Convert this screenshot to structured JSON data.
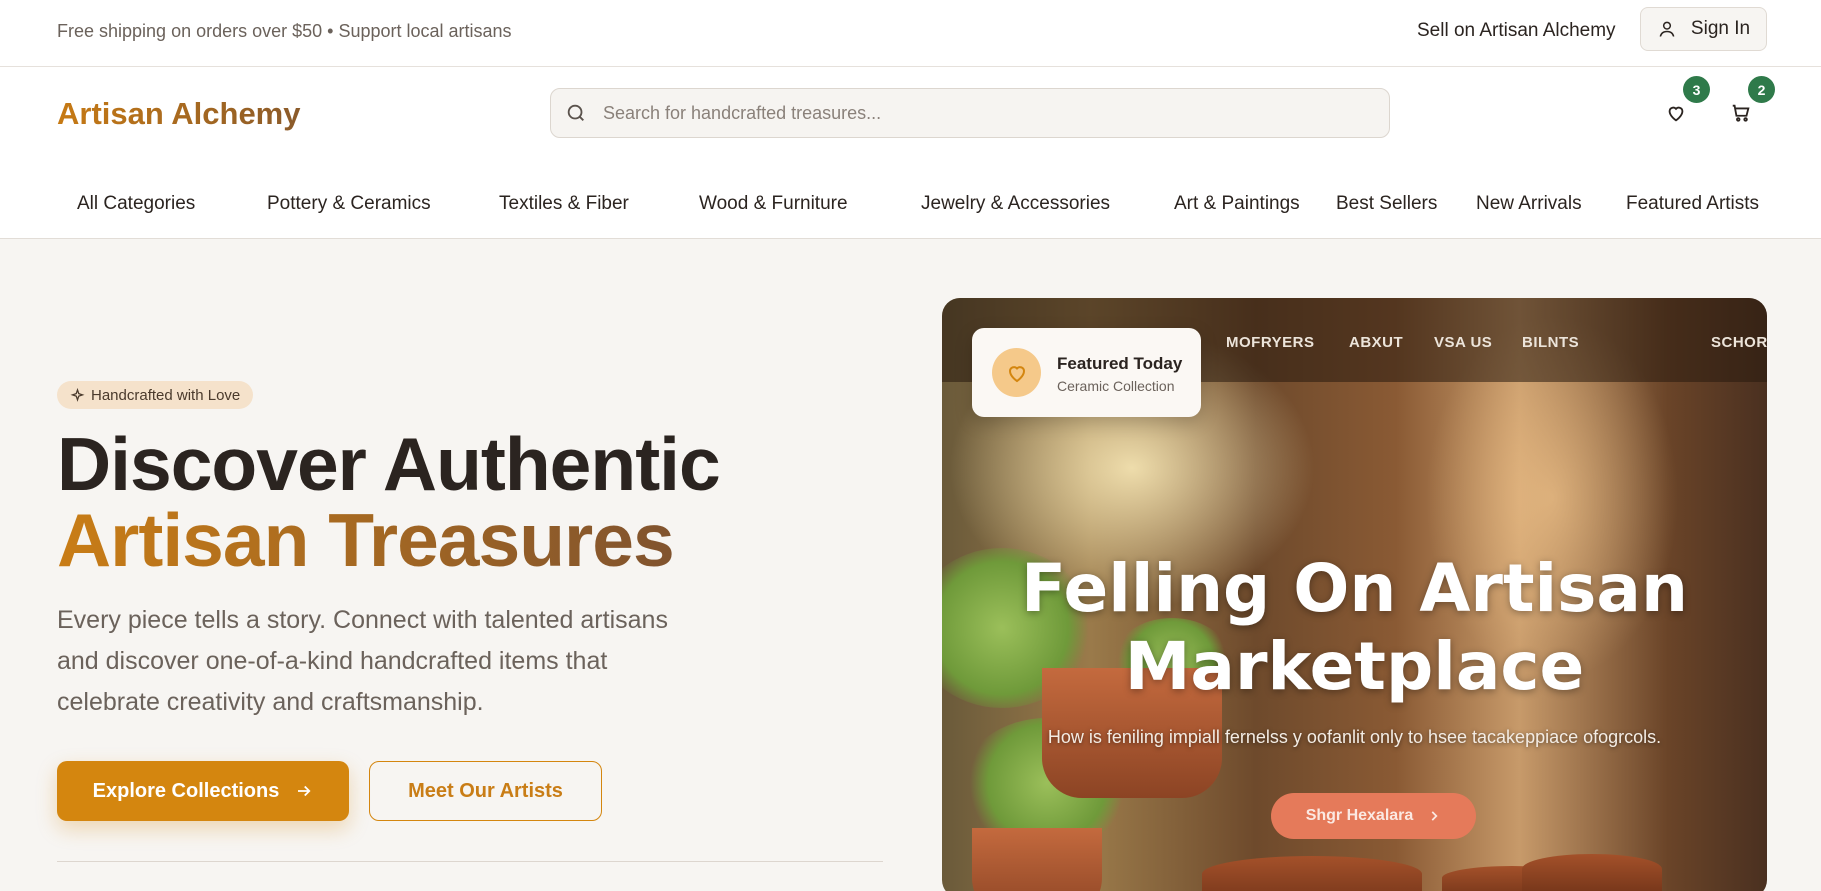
{
  "topbar": {
    "promo": "Free shipping on orders over $50 • Support local artisans",
    "sell_link": "Sell on Artisan Alchemy",
    "signin_label": "Sign In"
  },
  "header": {
    "logo": "Artisan Alchemy",
    "search_placeholder": "Search for handcrafted treasures...",
    "wishlist_count": "3",
    "cart_count": "2"
  },
  "nav": [
    "All Categories",
    "Pottery & Ceramics",
    "Textiles & Fiber",
    "Wood & Furniture",
    "Jewelry & Accessories",
    "Art & Paintings",
    "Best Sellers",
    "New Arrivals",
    "Featured Artists"
  ],
  "hero": {
    "pill": "Handcrafted with Love",
    "title_line1": "Discover Authentic",
    "title_line2": "Artisan Treasures",
    "subtitle": "Every piece tells a story. Connect with talented artisans and discover one-of-a-kind handcrafted items that celebrate creativity and craftsmanship.",
    "primary_cta": "Explore Collections",
    "secondary_cta": "Meet Our Artists"
  },
  "hero_image": {
    "nav_items": [
      "MOFRYERS",
      "ABXUT",
      "VSA US",
      "BILNTS",
      "SCHORO"
    ],
    "title_line1": "Felling On Artisan",
    "title_line2": "Marketplace",
    "subtitle": "How is feniling impiall fernelss y oofanlit only to hsee tacakeppiace ofogrcols.",
    "button": "Shgr Hexalara"
  },
  "featured_card": {
    "title": "Featured Today",
    "subtitle": "Ceramic Collection"
  },
  "colors": {
    "accent": "#d4860f",
    "badge": "#2f7a4a",
    "text": "#2b2420",
    "muted": "#6b625b"
  }
}
